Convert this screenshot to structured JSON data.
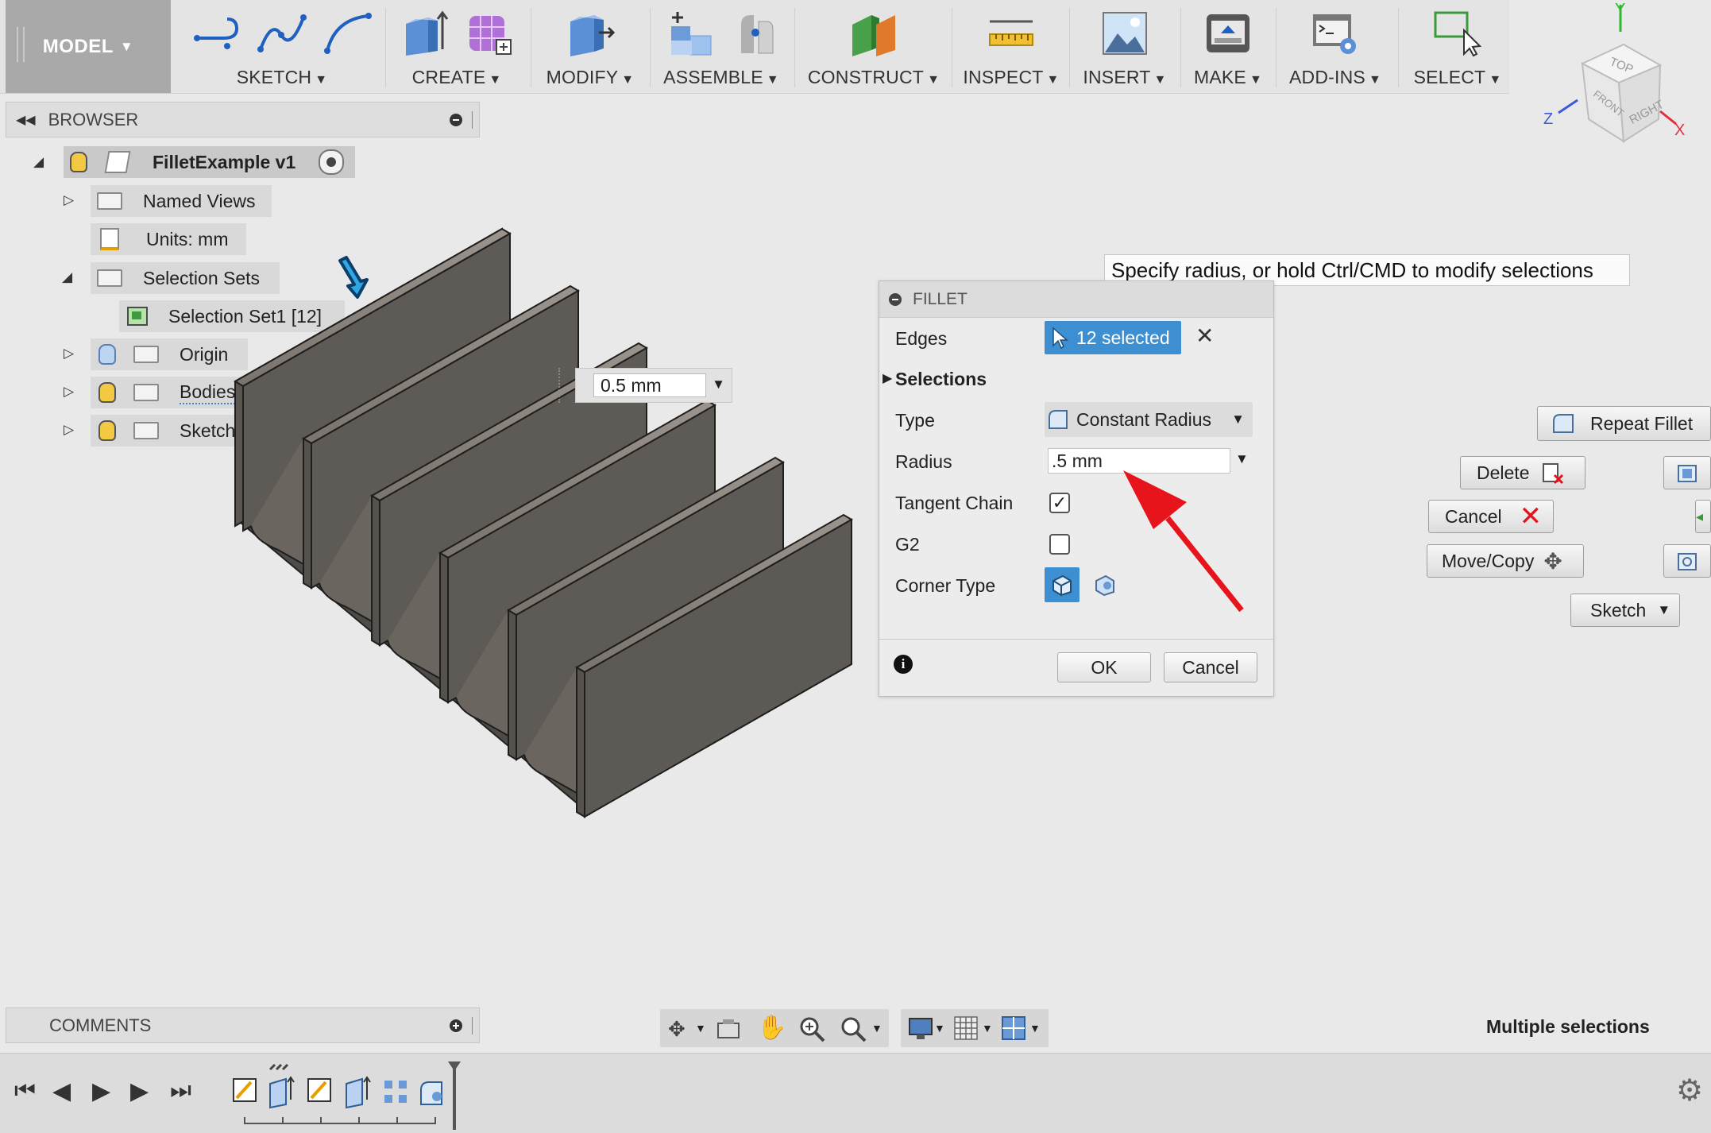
{
  "toolbar": {
    "workspace": "MODEL",
    "groups": [
      {
        "label": "SKETCH"
      },
      {
        "label": "CREATE"
      },
      {
        "label": "MODIFY"
      },
      {
        "label": "ASSEMBLE"
      },
      {
        "label": "CONSTRUCT"
      },
      {
        "label": "INSPECT"
      },
      {
        "label": "INSERT"
      },
      {
        "label": "MAKE"
      },
      {
        "label": "ADD-INS"
      },
      {
        "label": "SELECT"
      }
    ]
  },
  "viewcube": {
    "top": "TOP",
    "front": "FRONT",
    "right": "RIGHT",
    "axis_x": "X",
    "axis_y": "Y",
    "axis_z": "Z"
  },
  "browser": {
    "title": "BROWSER",
    "root": "FilletExample v1",
    "items": [
      {
        "label": "Named Views"
      },
      {
        "label": "Units: mm"
      },
      {
        "label": "Selection Sets"
      },
      {
        "label": "Selection Set1 [12]"
      },
      {
        "label": "Origin"
      },
      {
        "label": "Bodies"
      },
      {
        "label": "Sketches"
      }
    ]
  },
  "viewport": {
    "dimension_value": "0.5 mm"
  },
  "tooltip": "Specify radius, or hold Ctrl/CMD to modify selections",
  "fillet": {
    "title": "FILLET",
    "edges_label": "Edges",
    "edges_value": "12 selected",
    "selections_label": "Selections",
    "type_label": "Type",
    "type_value": "Constant Radius",
    "radius_label": "Radius",
    "radius_value": ".5 mm",
    "tangent_chain_label": "Tangent Chain",
    "tangent_chain_checked": true,
    "g2_label": "G2",
    "g2_checked": false,
    "corner_type_label": "Corner Type",
    "ok_label": "OK",
    "cancel_label": "Cancel"
  },
  "marking_menu": {
    "repeat": "Repeat Fillet",
    "delete": "Delete",
    "cancel": "Cancel",
    "move_copy": "Move/Copy",
    "sketch": "Sketch"
  },
  "comments": {
    "title": "COMMENTS"
  },
  "status": "Multiple selections",
  "colors": {
    "accent": "#3d8fd1",
    "arrow": "#e8141c",
    "body": "#5e5a55"
  }
}
